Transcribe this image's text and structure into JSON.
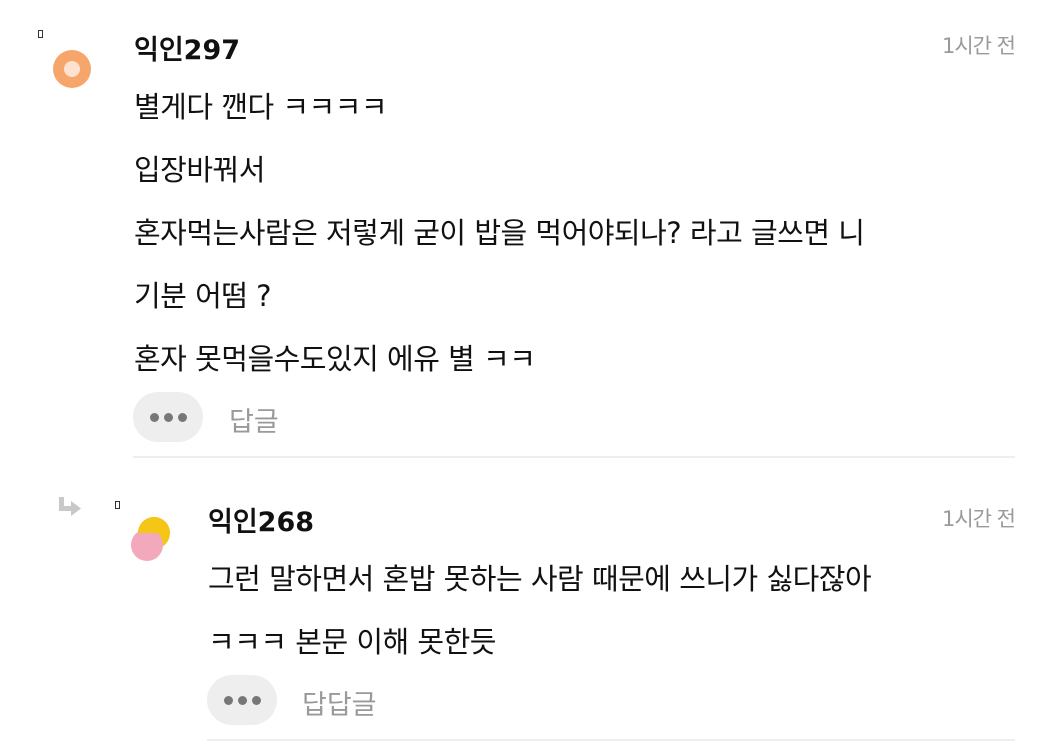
{
  "comments": [
    {
      "author": "익인297",
      "time": "1시간 전",
      "lines": [
        "별게다 깬다 ㅋㅋㅋㅋ",
        "입장바꿔서",
        "혼자먹는사람은 저렇게 굳이 밥을 먹어야되나? 라고 글쓰면 니",
        "기분 어떰 ?",
        "혼자 못먹을수도있지 에유 별 ㅋㅋ"
      ],
      "reply_label": "답글",
      "avatar_colors": {
        "outer": "#f7a66b",
        "inner": "#fde3cf"
      }
    },
    {
      "author": "익인268",
      "time": "1시간 전",
      "lines": [
        "그런 말하면서 혼밥 못하는 사람 때문에 쓰니가 싫다잖아",
        "ㅋㅋㅋ 본문 이해 못한듯"
      ],
      "reply_label": "답답글",
      "avatar_colors": {
        "top": "#f5c518",
        "bottom": "#f2a9bb"
      }
    }
  ],
  "icons": {
    "reply_arrow": "reply-arrow-icon",
    "more": "more-options-icon"
  }
}
